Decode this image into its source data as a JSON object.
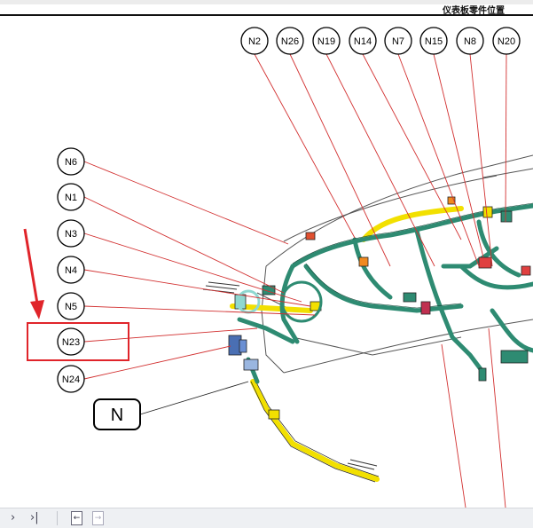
{
  "header": {
    "title": "仪表板零件位置"
  },
  "callouts_top": [
    "N2",
    "N26",
    "N19",
    "N14",
    "N7",
    "N15",
    "N8",
    "N20"
  ],
  "callouts_left": [
    "N6",
    "N1",
    "N3",
    "N4",
    "N5",
    "N23",
    "N24"
  ],
  "group_label": "N",
  "highlight_color": "#e0242a",
  "harness_colors": {
    "main": "#2e8b72",
    "secondary": "#f2e000",
    "connector": "#4a6fb3",
    "leader": "#d23030"
  },
  "footer": {
    "icons": [
      "next-page-icon",
      "last-page-icon",
      "doc-back-icon",
      "doc-forward-icon"
    ]
  }
}
